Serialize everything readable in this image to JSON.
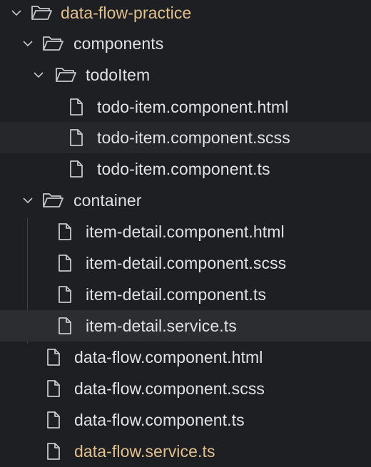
{
  "colors": {
    "background": "#1e1f22",
    "text": "#dfe1e5",
    "modified_text": "#e2c08d",
    "hover_row": "#2b2d31",
    "indent_guide": "#3d3f44"
  },
  "tree": {
    "root": {
      "label": "data-flow-practice",
      "icon": "folder-open-icon",
      "expanded": true,
      "modified": true
    },
    "components": {
      "label": "components",
      "icon": "folder-open-icon",
      "expanded": true
    },
    "todoItem": {
      "label": "todoItem",
      "icon": "folder-open-icon",
      "expanded": true,
      "files": [
        {
          "label": "todo-item.component.html",
          "icon": "file-icon"
        },
        {
          "label": "todo-item.component.scss",
          "icon": "file-icon"
        },
        {
          "label": "todo-item.component.ts",
          "icon": "file-icon"
        }
      ]
    },
    "container": {
      "label": "container",
      "icon": "folder-open-icon",
      "expanded": true,
      "files": [
        {
          "label": "item-detail.component.html",
          "icon": "file-icon"
        },
        {
          "label": "item-detail.component.scss",
          "icon": "file-icon"
        },
        {
          "label": "item-detail.component.ts",
          "icon": "file-icon"
        },
        {
          "label": "item-detail.service.ts",
          "icon": "file-icon"
        }
      ]
    },
    "root_files": [
      {
        "label": "data-flow.component.html",
        "icon": "file-icon"
      },
      {
        "label": "data-flow.component.scss",
        "icon": "file-icon"
      },
      {
        "label": "data-flow.component.ts",
        "icon": "file-icon"
      },
      {
        "label": "data-flow.service.ts",
        "icon": "file-icon",
        "modified": true
      }
    ]
  }
}
